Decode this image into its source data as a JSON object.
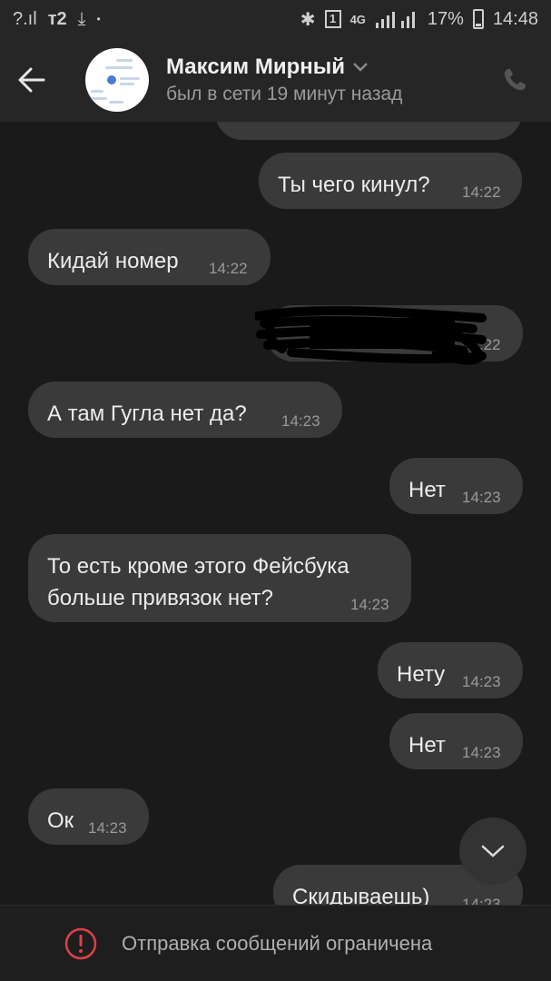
{
  "status_bar": {
    "carrier": "?.ıl",
    "operator": "т2",
    "download": "⤓",
    "dot": "•",
    "bluetooth": "✱",
    "sim_badge": "1",
    "network": "4G",
    "battery_percent": "17%",
    "battery_level": 0.17,
    "time": "14:48"
  },
  "header": {
    "contact_name": "Максим Мирный",
    "last_seen": "был в сети 19 минут назад",
    "back_icon": "arrow-left-icon",
    "call_icon": "phone-icon"
  },
  "messages": [
    {
      "side": "out",
      "text": "Ты чего кинул?",
      "time": "14:22"
    },
    {
      "side": "in",
      "text": "Кидай номер",
      "time": "14:22"
    },
    {
      "side": "out",
      "text": "",
      "time": "14:22",
      "redacted": true
    },
    {
      "side": "in",
      "text": "А там Гугла нет да?",
      "time": "14:23"
    },
    {
      "side": "out",
      "text": "Нет",
      "time": "14:23"
    },
    {
      "side": "in",
      "text": "То есть кроме этого Фейсбука\nбольше привязок нет?",
      "time": "14:23"
    },
    {
      "side": "out",
      "text": "Нету",
      "time": "14:23"
    },
    {
      "side": "out",
      "text": "Нет",
      "time": "14:23"
    },
    {
      "side": "in",
      "text": "Ок",
      "time": "14:23"
    },
    {
      "side": "out",
      "text": "Скидываешь)",
      "time": "14:23"
    }
  ],
  "footer": {
    "notice": "Отправка сообщений ограничена",
    "icon": "warning-circle-icon",
    "accent": "#e0404a"
  },
  "colors": {
    "background": "#1a1a1a",
    "bar": "#262626",
    "bubble": "#3a3a3a"
  }
}
